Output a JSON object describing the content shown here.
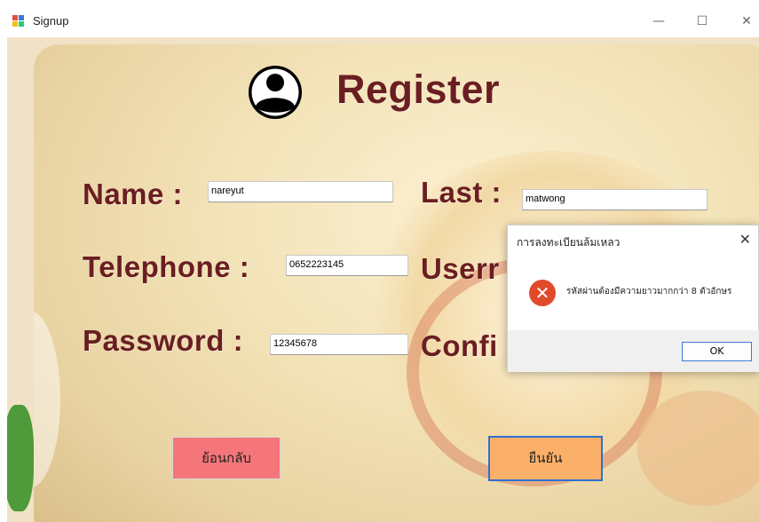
{
  "window": {
    "title": "Signup",
    "minimize_glyph": "—",
    "maximize_glyph": "☐",
    "close_glyph": "✕"
  },
  "form": {
    "heading": "Register",
    "name_label": "Name :",
    "name_value": "nareyut",
    "last_label": "Last :",
    "last_value": "matwong",
    "telephone_label": "Telephone :",
    "telephone_value": "0652223145",
    "username_label": "Userr",
    "password_label": "Password :",
    "password_value": "12345678",
    "confirm_label": "Confi",
    "back_button": "ย้อนกลับ",
    "confirm_button": "ยืนยัน"
  },
  "dialog": {
    "title": "การลงทะเบียนล้มเหลว",
    "message": "รหัสผ่านต้องมีความยาวมากกว่า 8 ตัวอักษร",
    "ok_label": "OK",
    "close_glyph": "✕",
    "icon": "error-icon",
    "icon_glyph": "✕"
  },
  "colors": {
    "label": "#6a1e22",
    "back_button": "#f4767a",
    "confirm_button": "#fbb06a",
    "error_icon": "#e04a2a",
    "ok_border": "#3b7bd6"
  }
}
